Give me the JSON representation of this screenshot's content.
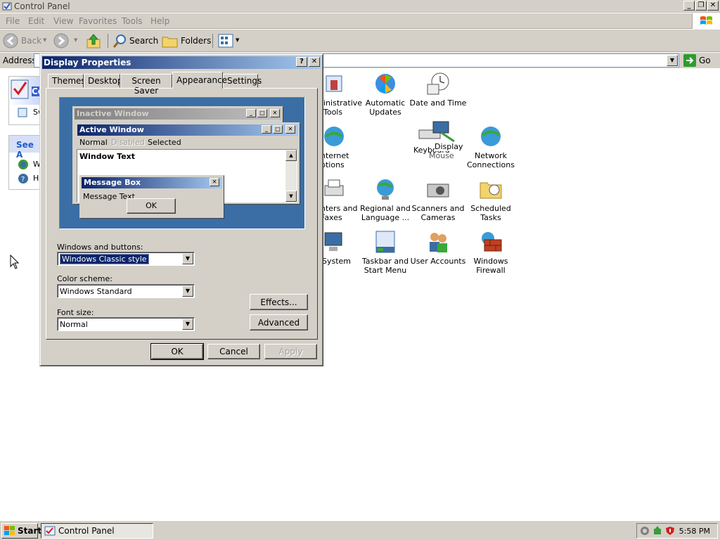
{
  "window": {
    "title": "Control Panel"
  },
  "menu": [
    "File",
    "Edit",
    "View",
    "Favorites",
    "Tools",
    "Help"
  ],
  "toolbar": {
    "back": "Back",
    "search": "Search",
    "folders": "Folders"
  },
  "address": {
    "label": "Address",
    "go": "Go"
  },
  "left_pane": {
    "panel_title": "Co",
    "switch_text": "Sw",
    "see_also": "See A",
    "link1": "W",
    "link2": "He"
  },
  "icons": [
    {
      "label": "inistrative Tools"
    },
    {
      "label": "Automatic Updates"
    },
    {
      "label": "Date and Time"
    },
    {
      "label": "nternet ptions"
    },
    {
      "label": "Keyboard"
    },
    {
      "label": "Display"
    },
    {
      "label": "Mouse"
    },
    {
      "label": "Network Connections"
    },
    {
      "label": "nters and Faxes"
    },
    {
      "label": "Regional and Language ..."
    },
    {
      "label": "Scanners and Cameras"
    },
    {
      "label": "Scheduled Tasks"
    },
    {
      "label": "System"
    },
    {
      "label": "Taskbar and Start Menu"
    },
    {
      "label": "User Accounts"
    },
    {
      "label": "Windows Firewall"
    }
  ],
  "dialog": {
    "title": "Display Properties",
    "tabs": [
      "Themes",
      "Desktop",
      "Screen Saver",
      "Appearance",
      "Settings"
    ],
    "active_tab": "Appearance",
    "preview": {
      "inactive_title": "Inactive Window",
      "active_title": "Active Window",
      "menu_normal": "Normal",
      "menu_disabled": "Disabled",
      "menu_selected": "Selected",
      "window_text": "Window Text",
      "msgbox_title": "Message Box",
      "msgbox_text": "Message Text",
      "msgbox_ok": "OK"
    },
    "windows_buttons_label": "Windows and buttons:",
    "windows_buttons_value": "Windows Classic style",
    "color_scheme_label": "Color scheme:",
    "color_scheme_value": "Windows Standard",
    "font_size_label": "Font size:",
    "font_size_value": "Normal",
    "effects": "Effects...",
    "advanced": "Advanced",
    "ok": "OK",
    "cancel": "Cancel",
    "apply": "Apply"
  },
  "taskbar": {
    "start": "Start",
    "task": "Control Panel",
    "clock": "5:58 PM"
  },
  "colors": {
    "active_title": "#0a246a",
    "desktop_preview": "#3a6ea5",
    "face": "#d4d0c8"
  }
}
